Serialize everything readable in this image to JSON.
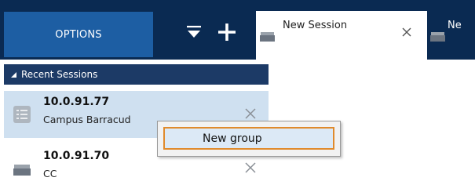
{
  "toolbar": {
    "options_label": "OPTIONS",
    "filter_icon": "filter-icon",
    "add_icon": "plus-icon"
  },
  "tabs": [
    {
      "label": "New Session",
      "icon": "monitor-icon",
      "close_icon": "close-icon"
    },
    {
      "label": "Ne",
      "icon": "monitor-icon"
    }
  ],
  "sidebar": {
    "section_title": "Recent Sessions",
    "sessions": [
      {
        "ip": "10.0.91.77",
        "description": "Campus Barracud",
        "icon": "server-icon"
      },
      {
        "ip": "10.0.91.70",
        "description": "CC",
        "icon": "monitor-icon"
      }
    ]
  },
  "context_menu": {
    "items": [
      {
        "label": "New group"
      }
    ]
  },
  "colors": {
    "topbar": "#0a2a52",
    "options_button": "#1d5ea3",
    "section_header": "#1c3a66",
    "selected_row": "#cfe0f0",
    "menu_highlight_border": "#e08a2c"
  }
}
